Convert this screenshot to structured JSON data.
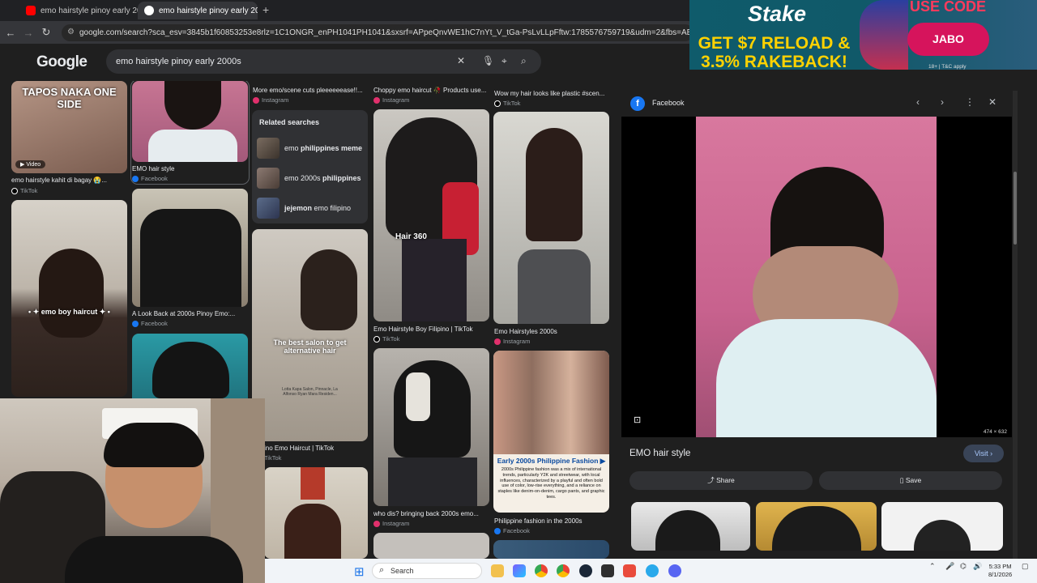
{
  "browser": {
    "tabs": [
      {
        "title": "emo hairstyle pinoy early 2000s",
        "active": false
      },
      {
        "title": "emo hairstyle pinoy early 2000s",
        "active": true
      }
    ],
    "url": "google.com/search?sca_esv=3845b1f60853253e8rlz=1C1ONGR_enPH1041PH1041&sxsrf=APpeQnvWE1hC7nYt_V_tGa-PsLvLLpFftw:1785576759719&udm=2&fbs=ABfTbFVyMZGZf1hfvX9uKJN_-G"
  },
  "google": {
    "logo": "Google",
    "query": "emo hairstyle pinoy early 2000s"
  },
  "grid": {
    "col1": [
      {
        "overlay": "TAPOS NAKA ONE SIDE",
        "badge": "Video",
        "caption": "emo hairstyle kahit di bagay 😭...",
        "source": "TikTok"
      },
      {
        "overlay": "• ✦ emo boy haircut ✦ •"
      }
    ],
    "col2": [
      {
        "caption": "EMO hair style",
        "source": "Facebook"
      },
      {
        "caption": "A Look Back at 2000s Pinoy Emo:...",
        "source": "Facebook"
      }
    ],
    "col3_top": {
      "caption": "More emo/scene cuts pleeeeeease!!...",
      "source": "Instagram"
    },
    "related": {
      "title": "Related searches",
      "items": [
        {
          "prefix": "emo ",
          "bold": "philippines meme"
        },
        {
          "prefix": "emo 2000s ",
          "bold": "philippines"
        },
        {
          "prefix": "",
          "bold": "jejemon",
          "suffix": " emo filipino"
        }
      ]
    },
    "col3_mid": {
      "overlay": "The best salon to get alternative hair",
      "subtext": "Lotta Kapa Salon, Pinnacle, La Alfonso Ryan Mara Residen...",
      "caption": "ino Emo Haircut | TikTok",
      "source": "TikTok"
    },
    "col4": [
      {
        "caption": "Choppy emo haircut 🥀 Products use...",
        "source": "Instagram"
      },
      {
        "overlay": "Hair 360",
        "caption": "Emo Hairstyle Boy Filipino | TikTok",
        "source": "TikTok"
      },
      {
        "caption": "who dis? bringing back 2000s emo...",
        "source": "Instagram"
      }
    ],
    "col5": [
      {
        "caption": "Wow my hair looks like plastic #scen...",
        "source": "TikTok"
      },
      {
        "caption": "Emo Hairstyles 2000s",
        "source": "Instagram"
      },
      {
        "heading": "Early 2000s Philippine Fashion ▶",
        "body": "2000s Philippine fashion was a mix of international trends, particularly Y2K and streetwear, with local influences, characterized by a playful and often bold use of color, low-rise everything, and a reliance on staples like denim-on-denim, cargo pants, and graphic tees.",
        "caption": "Philippine fashion in the 2000s",
        "source": "Facebook"
      }
    ]
  },
  "panel": {
    "source": "Facebook",
    "dimensions": "474 × 632",
    "title": "EMO hair style",
    "visit_label": "Visit",
    "share_label": "Share",
    "save_label": "Save"
  },
  "ad": {
    "brand": "Stake",
    "promo": "GET $7 RELOAD & 3.5% RAKEBACK!",
    "code_label": "USE CODE",
    "code": "JABO",
    "legal": "18+ | T&C apply"
  },
  "taskbar": {
    "search_placeholder": "Search",
    "time": "5:33 PM",
    "date": "8/1/2026"
  },
  "colors": {
    "facebook": "#1877f2",
    "instagram": "#e1306c",
    "tiktok": "#ffffff",
    "accent_blue": "#a8c7fa",
    "stake_yellow": "#ffd200",
    "stake_pink": "#d6145c"
  }
}
